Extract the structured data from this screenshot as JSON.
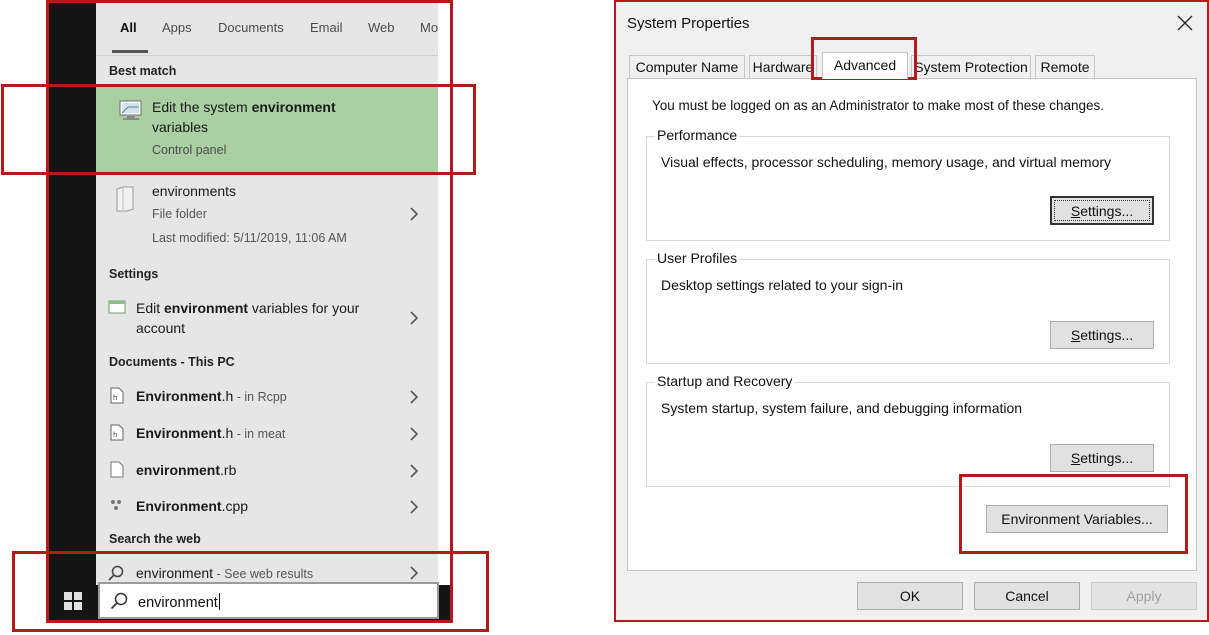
{
  "start_menu": {
    "filter_tabs": [
      "All",
      "Apps",
      "Documents",
      "Email",
      "Web",
      "More"
    ],
    "active_tab": "All",
    "best_match": {
      "heading": "Best match",
      "title_line1_prefix": "Edit the system ",
      "title_line1_bold": "environment",
      "title_line2": "variables",
      "subtitle": "Control panel",
      "icon": "monitor-icon",
      "highlight_color": "#a9cfa3"
    },
    "folder_result": {
      "name": "environments",
      "type": "File folder",
      "modified": "Last modified: 5/11/2019, 11:06 AM",
      "icon": "folder-icon"
    },
    "settings": {
      "heading": "Settings",
      "item_prefix": "Edit ",
      "item_bold": "environment",
      "item_suffix": " variables for your",
      "item_line2": "account",
      "icon": "settings-window-icon"
    },
    "documents": {
      "heading": "Documents - This PC",
      "items": [
        {
          "bold": "Environment",
          "ext": ".h",
          "location": " - in Rcpp",
          "icon": "header-file-icon"
        },
        {
          "bold": "Environment",
          "ext": ".h",
          "location": " - in meat",
          "icon": "header-file-icon"
        },
        {
          "bold": "environment",
          "ext": ".rb",
          "location": "",
          "icon": "text-file-icon"
        },
        {
          "bold": "Environment",
          "ext": ".cpp",
          "location": "",
          "icon": "cpp-file-icon"
        }
      ]
    },
    "web": {
      "heading": "Search the web",
      "query": "environment",
      "suffix": " - See web results"
    },
    "search_box": {
      "value": "environment",
      "icon": "search-icon"
    },
    "taskbar_icon": "windows-start-icon"
  },
  "dialog": {
    "title": "System Properties",
    "tabs": [
      "Computer Name",
      "Hardware",
      "Advanced",
      "System Protection",
      "Remote"
    ],
    "active_tab": "Advanced",
    "admin_note": "You must be logged on as an Administrator to make most of these changes.",
    "groups": [
      {
        "label": "Performance",
        "desc": "Visual effects, processor scheduling, memory usage, and virtual memory",
        "button": "Settings..."
      },
      {
        "label": "User Profiles",
        "desc": "Desktop settings related to your sign-in",
        "button": "Settings..."
      },
      {
        "label": "Startup and Recovery",
        "desc": "System startup, system failure, and debugging information",
        "button": "Settings..."
      }
    ],
    "env_button": "Environment Variables...",
    "footer_buttons": {
      "ok": "OK",
      "cancel": "Cancel",
      "apply": "Apply"
    }
  },
  "colors": {
    "highlight_border": "#b31b1b",
    "taskbar": "#141414",
    "search_pane": "#e6e6e6"
  }
}
